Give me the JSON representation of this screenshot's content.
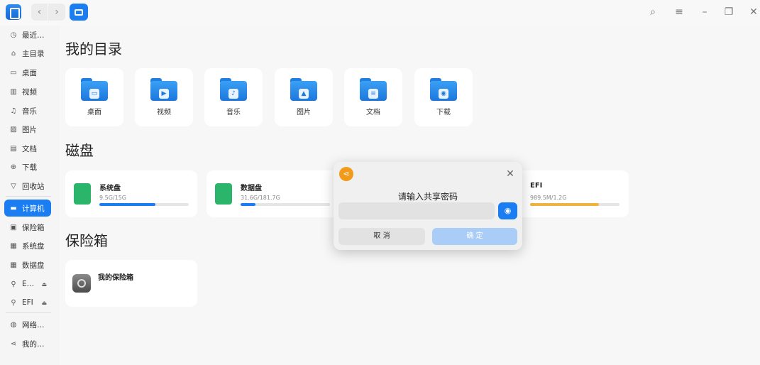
{
  "titlebar": {
    "back": "‹",
    "forward": "›",
    "controls": {
      "search": "⌕",
      "menu": "≡",
      "minimize": "–",
      "maximize": "❐",
      "close": "✕"
    }
  },
  "sidebar": {
    "items": [
      {
        "label": "最近…",
        "icon": "clock-icon",
        "glyph": "◷"
      },
      {
        "label": "主目录",
        "icon": "home-icon",
        "glyph": "⌂"
      },
      {
        "label": "桌面",
        "icon": "desktop-icon",
        "glyph": "▭"
      },
      {
        "label": "视频",
        "icon": "video-icon",
        "glyph": "▥"
      },
      {
        "label": "音乐",
        "icon": "music-icon",
        "glyph": "♫"
      },
      {
        "label": "图片",
        "icon": "picture-icon",
        "glyph": "▨"
      },
      {
        "label": "文档",
        "icon": "document-icon",
        "glyph": "▤"
      },
      {
        "label": "下载",
        "icon": "download-icon",
        "glyph": "⊕"
      },
      {
        "label": "回收站",
        "icon": "trash-icon",
        "glyph": "▽"
      },
      {
        "label": "计算机",
        "icon": "computer-icon",
        "glyph": "▬"
      },
      {
        "label": "保险箱",
        "icon": "vault-icon",
        "glyph": "▣"
      },
      {
        "label": "系统盘",
        "icon": "disk-icon",
        "glyph": "▦"
      },
      {
        "label": "数据盘",
        "icon": "disk-icon",
        "glyph": "▦"
      },
      {
        "label": "E…",
        "icon": "usb-icon",
        "glyph": "⚲",
        "eject": "⏏"
      },
      {
        "label": "EFI",
        "icon": "usb-icon",
        "glyph": "⚲",
        "eject": "⏏"
      },
      {
        "label": "网络…",
        "icon": "network-icon",
        "glyph": "◍"
      },
      {
        "label": "我的…",
        "icon": "share-icon",
        "glyph": "⋖"
      }
    ]
  },
  "main": {
    "my_dirs_title": "我的目录",
    "dirs": [
      {
        "label": "桌面",
        "emblem": "▭"
      },
      {
        "label": "视频",
        "emblem": "▶"
      },
      {
        "label": "音乐",
        "emblem": "♪"
      },
      {
        "label": "图片",
        "emblem": "▲"
      },
      {
        "label": "文档",
        "emblem": "≡"
      },
      {
        "label": "下载",
        "emblem": "◉"
      }
    ],
    "disks_title": "磁盘",
    "disks": [
      {
        "name": "系统盘",
        "size": "9.5G/15G",
        "usage": 0.63,
        "color": "#1a7ef2",
        "icon_color": "#2ab56a"
      },
      {
        "name": "数据盘",
        "size": "31.6G/181.7G",
        "usage": 0.17,
        "color": "#1a7ef2",
        "icon_color": "#2ab56a"
      },
      {
        "name": "EFI",
        "size": "989.5M/1.2G",
        "usage": 0.77,
        "color": "#f0b43c"
      }
    ],
    "vault_title": "保险箱",
    "vault_name": "我的保险箱"
  },
  "dialog": {
    "title": "请输入共享密码",
    "input_value": "",
    "eye": "◉",
    "cancel": "取 消",
    "confirm": "确 定",
    "close": "✕",
    "share_glyph": "⋖"
  },
  "colors": {
    "accent": "#1a7ef2",
    "share": "#f29a1a",
    "efi_bar": "#f0b43c"
  }
}
